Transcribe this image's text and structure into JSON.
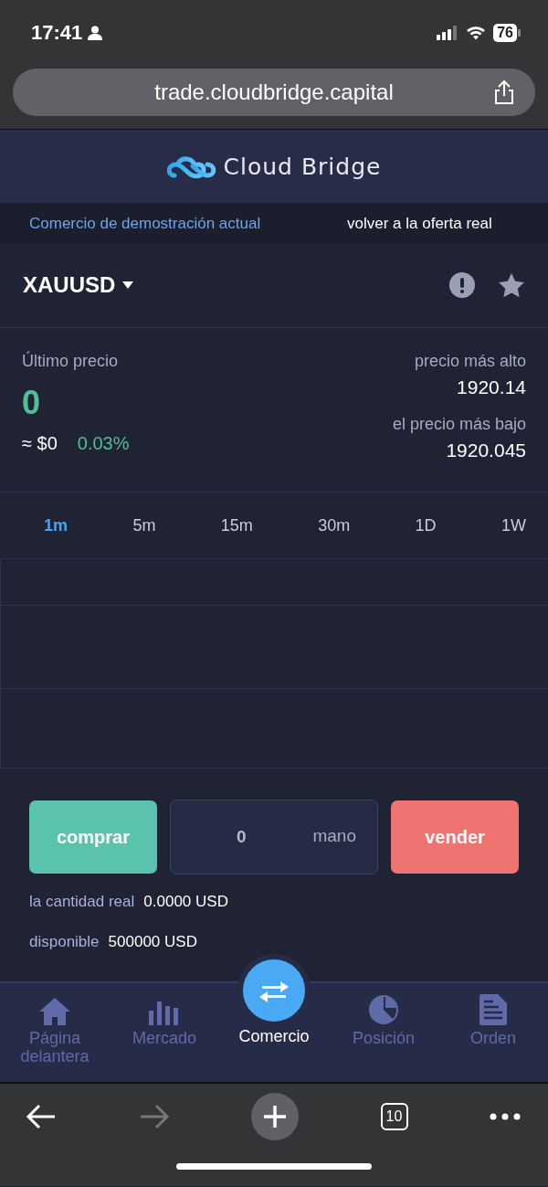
{
  "status_bar": {
    "time": "17:41",
    "battery": "76"
  },
  "browser": {
    "url": "trade.cloudbridge.capital",
    "tab_count": "10"
  },
  "header": {
    "brand": "Cloud Bridge"
  },
  "account_bar": {
    "current": "Comercio de demostración actual",
    "switch_link": "volver a la oferta real"
  },
  "instrument": {
    "symbol": "XAUUSD"
  },
  "prices": {
    "last_label": "Último precio",
    "last_value": "0",
    "approx": "≈ $0",
    "change": "0.03%",
    "high_label": "precio más alto",
    "high_value": "1920.14",
    "low_label": "el precio más bajo",
    "low_value": "1920.045"
  },
  "intervals": [
    {
      "label": "1m",
      "selected": true
    },
    {
      "label": "5m",
      "selected": false
    },
    {
      "label": "15m",
      "selected": false
    },
    {
      "label": "30m",
      "selected": false
    },
    {
      "label": "1D",
      "selected": false
    },
    {
      "label": "1W",
      "selected": false
    }
  ],
  "order": {
    "buy": "comprar",
    "quantity": "0",
    "unit": "mano",
    "sell": "vender"
  },
  "balances": [
    {
      "label": "la cantidad real",
      "value": "0.0000 USD"
    },
    {
      "label": "disponible",
      "value": "500000 USD"
    }
  ],
  "nav": [
    {
      "kind": "home",
      "label": "Página delantera",
      "selected": false
    },
    {
      "kind": "market",
      "label": "Mercado",
      "selected": false
    },
    {
      "kind": "trade",
      "label": "Comercio",
      "selected": true
    },
    {
      "kind": "position",
      "label": "Posición",
      "selected": false
    },
    {
      "kind": "order",
      "label": "Orden",
      "selected": false
    }
  ]
}
